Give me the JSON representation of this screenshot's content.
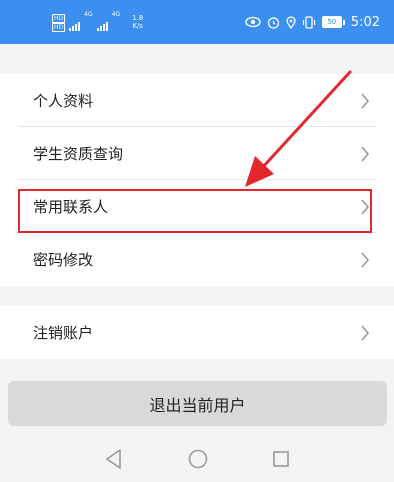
{
  "status_bar": {
    "sim1": "HD",
    "sim2": "HD",
    "net1": "4G",
    "net2": "4G",
    "speed_value": "1.8",
    "speed_unit": "K/s",
    "battery": "50",
    "time": "5:02",
    "icons": [
      "eye-icon",
      "alarm-icon",
      "location-icon",
      "vibrate-icon",
      "battery-icon"
    ]
  },
  "menu": {
    "items": [
      {
        "label": "个人资料"
      },
      {
        "label": "学生资质查询"
      },
      {
        "label": "常用联系人"
      },
      {
        "label": "密码修改"
      }
    ],
    "deregister": {
      "label": "注销账户"
    }
  },
  "logout_button": {
    "label": "退出当前用户"
  },
  "annotation": {
    "color": "#e3272e"
  },
  "colors": {
    "status_bar": "#3a8ff0",
    "background": "#f3f3f5",
    "button": "#d9d9d9"
  },
  "nav_bar": {
    "icons": [
      "back-icon",
      "home-icon",
      "recents-icon"
    ]
  }
}
